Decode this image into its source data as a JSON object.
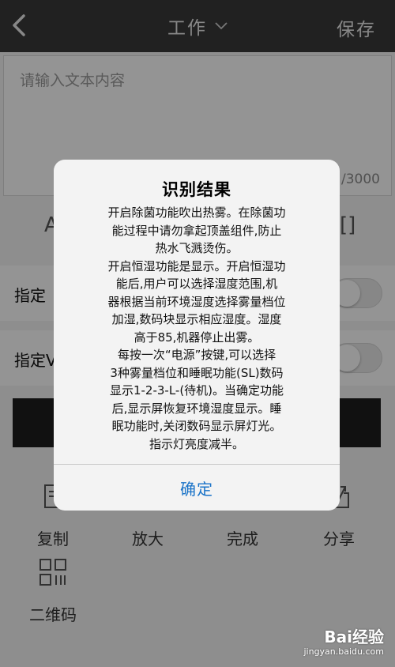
{
  "header": {
    "title": "工作",
    "save_label": "保存"
  },
  "editor": {
    "placeholder": "请输入文本内容",
    "counter": "/3000"
  },
  "toolbar": {
    "a_glyph": "A",
    "bracket_glyph": "[]"
  },
  "settings": {
    "row1_label": "指定",
    "row2_label": "指定V"
  },
  "actions": {
    "copy": "复制",
    "zoom": "放大",
    "done": "完成",
    "share": "分享",
    "qrcode": "二维码"
  },
  "dialog": {
    "title": "识别结果",
    "lines": [
      "开启除菌功能吹出热雾。在除菌功",
      "能过程中请勿拿起顶盖组件,防止",
      "热水飞溅烫伤。",
      "开启恒湿功能是显示。开启恒湿功",
      "能后,用户可以选择湿度范围,机",
      "器根据当前环境湿度选择雾量档位",
      "加湿,数码块显示相应湿度。湿度",
      "高于85,机器停止出雾。",
      "每按一次“电源”按键,可以选择",
      "3种雾量档位和睡眠功能(SL)数码",
      "显示1-2-3-L-(待机)。当确定功能",
      "后,显示屏恢复环境湿度显示。睡",
      "眠功能时,关闭数码显示屏灯光。",
      "指示灯亮度减半。"
    ],
    "ok_label": "确定"
  },
  "watermark": {
    "brand": "Bai经验",
    "url": "jingyan.baidu.com"
  },
  "colors": {
    "topbar": "#3a3a3a",
    "accent": "#1a73c8",
    "overlay": "rgba(0,0,0,0.42)"
  }
}
